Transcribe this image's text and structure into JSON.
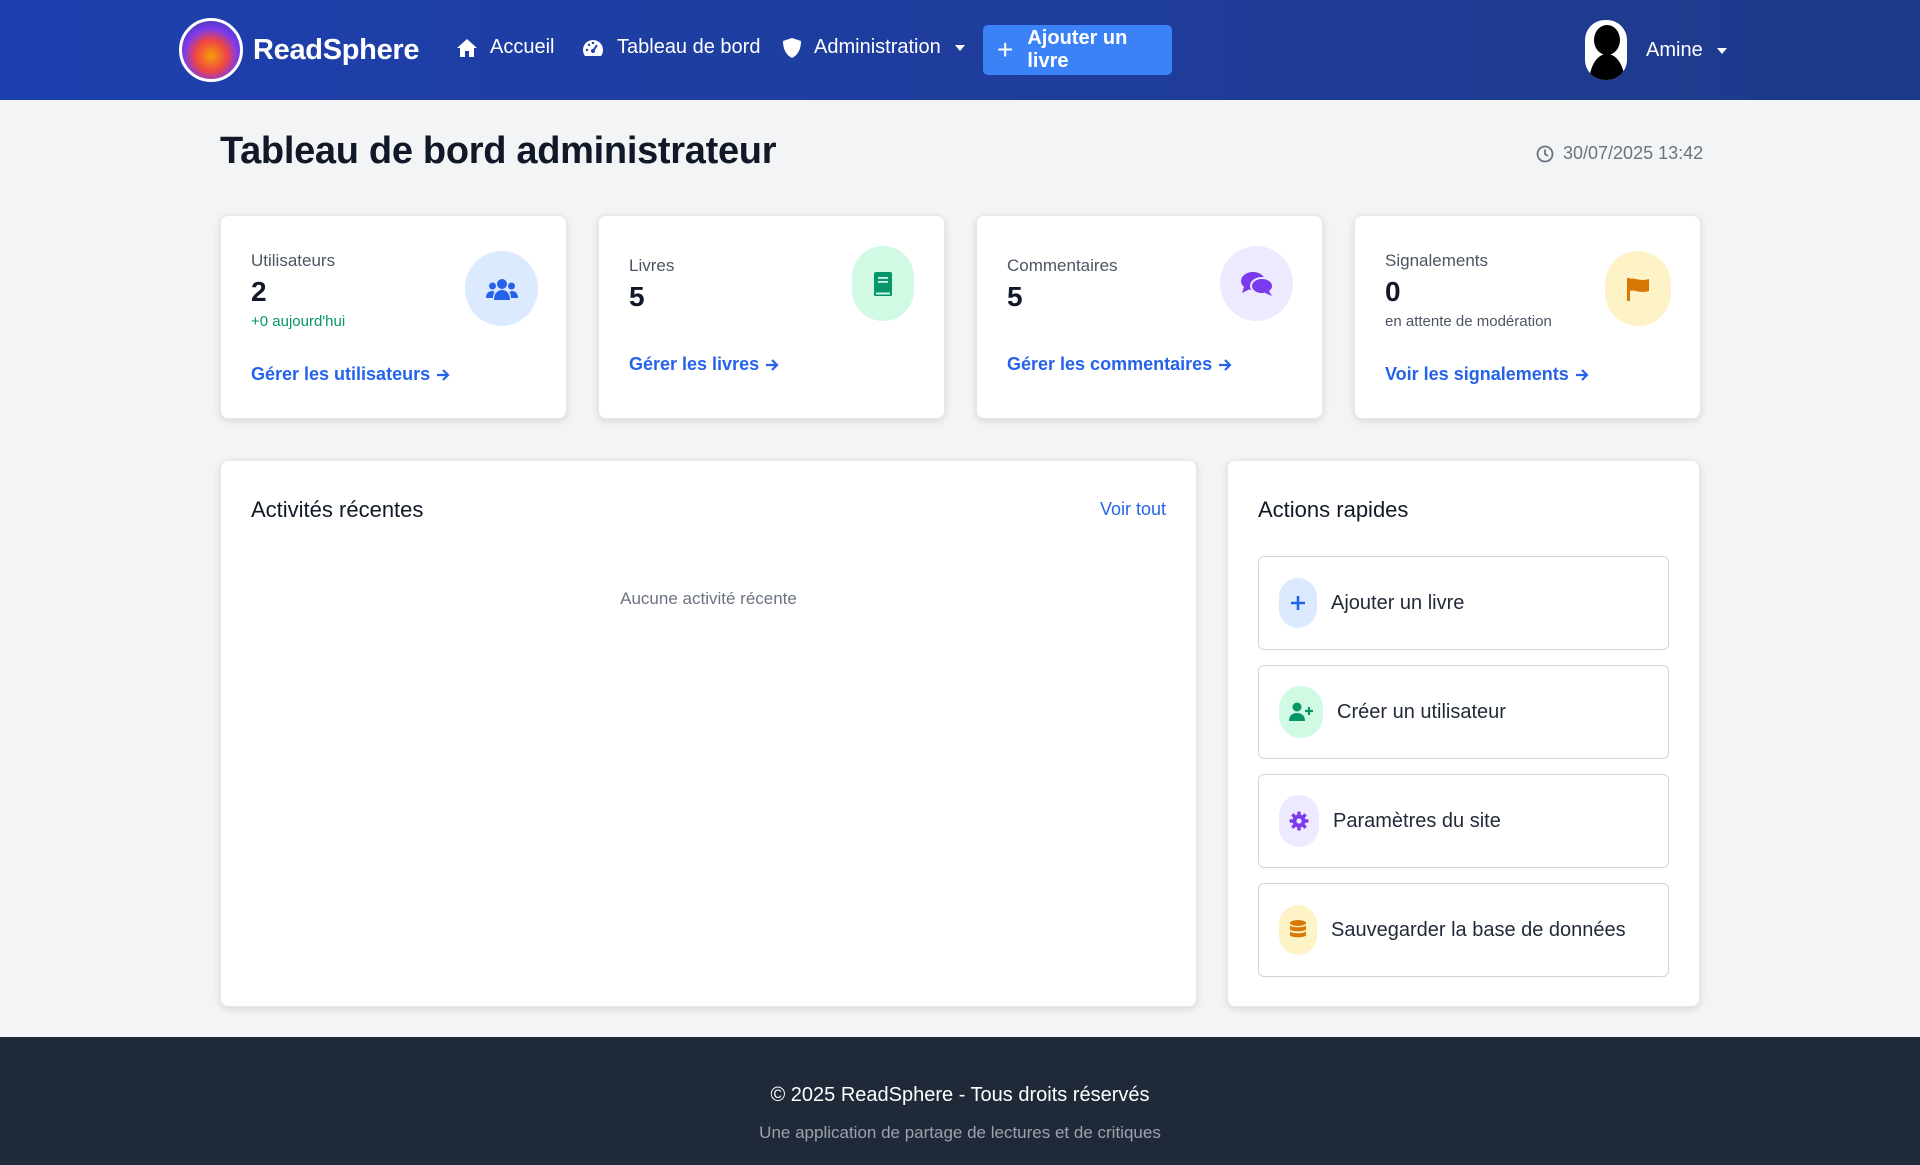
{
  "navbar": {
    "brand": "ReadSphere",
    "home": "Accueil",
    "dashboard": "Tableau de bord",
    "admin": "Administration",
    "add_book": "Ajouter un livre",
    "user": "Amine"
  },
  "header": {
    "title": "Tableau de bord administrateur",
    "datetime": "30/07/2025 13:42"
  },
  "stats": {
    "users": {
      "label": "Utilisateurs",
      "value": "2",
      "sub": "+0 aujourd'hui",
      "link": "Gérer les utilisateurs",
      "icon": "users-icon",
      "color": "#3b82f6"
    },
    "books": {
      "label": "Livres",
      "value": "5",
      "link": "Gérer les livres",
      "icon": "book-icon",
      "color": "#10b981"
    },
    "comments": {
      "label": "Commentaires",
      "value": "5",
      "link": "Gérer les commentaires",
      "icon": "comments-icon",
      "color": "#8b5cf6"
    },
    "reports": {
      "label": "Signalements",
      "value": "0",
      "sub": "en attente de modération",
      "link": "Voir les signalements",
      "icon": "flag-icon",
      "color": "#f59e0b"
    }
  },
  "activities": {
    "title": "Activités récentes",
    "see_all": "Voir tout",
    "empty": "Aucune activité récente"
  },
  "quick_actions": {
    "title": "Actions rapides",
    "items": [
      {
        "label": "Ajouter un livre",
        "icon": "plus-icon"
      },
      {
        "label": "Créer un utilisateur",
        "icon": "user-plus-icon"
      },
      {
        "label": "Paramètres du site",
        "icon": "gear-icon"
      },
      {
        "label": "Sauvegarder la base de données",
        "icon": "database-icon"
      }
    ]
  },
  "footer": {
    "copyright": "© 2025 ReadSphere - Tous droits réservés",
    "tagline": "Une application de partage de lectures et de critiques"
  }
}
